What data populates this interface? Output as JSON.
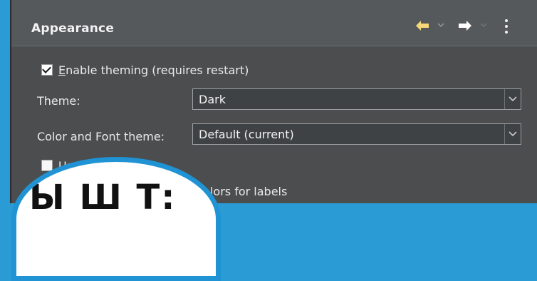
{
  "window": {
    "title": "Appearance",
    "nav": {
      "back_icon": "back-arrow-icon",
      "back_dropdown_icon": "chevron-down-icon",
      "forward_icon": "forward-arrow-icon",
      "forward_dropdown_icon": "chevron-down-icon",
      "menu_icon": "kebab-menu-icon"
    }
  },
  "settings": {
    "enable_theming": {
      "label_prefix": "E",
      "label_rest": "nable theming (requires restart)",
      "checked": true
    },
    "theme": {
      "label": "Theme:",
      "value": "Dark"
    },
    "color_font_theme": {
      "label": "Color and Font theme:",
      "value": "Default (current)"
    },
    "use_round_tabs": {
      "label": "Use round tabs",
      "checked": false
    },
    "partial_label": "nd colors for labels"
  },
  "overlay": {
    "text": "Ы Ш Т:"
  },
  "colors": {
    "panel_bg": "#4b4d4f",
    "header_bg": "#56595c",
    "accent_back_arrow": "#f6d77a",
    "overlay_border": "#1f93d3"
  }
}
